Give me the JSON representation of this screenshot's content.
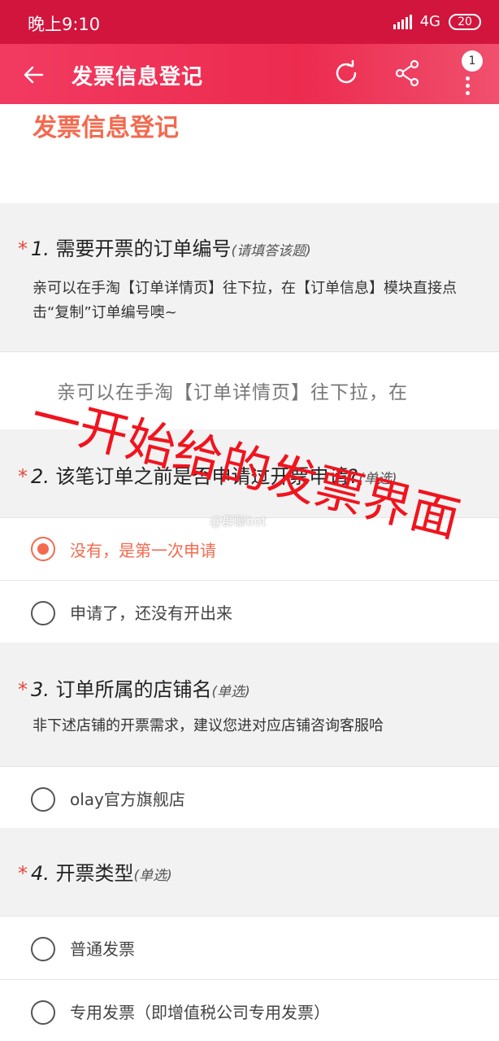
{
  "status_bar": {
    "time": "晚上9:10",
    "network": "4G",
    "battery": "20"
  },
  "app_bar": {
    "title": "发票信息登记",
    "badge_count": "1"
  },
  "form": {
    "title": "发票信息登记"
  },
  "questions": [
    {
      "star": "*",
      "number": "1.",
      "title": "需要开票的订单编号",
      "hint": "(请填答该题)",
      "description": "亲可以在手淘【订单详情页】往下拉，在【订单信息】模块直接点击“复制”订单编号噢~",
      "answer_placeholder": "亲可以在手淘【订单详情页】往下拉，在"
    },
    {
      "star": "*",
      "number": "2.",
      "title": "该笔订单之前是否申请过开票申请?",
      "hint": "(单选)",
      "options": [
        {
          "label": "没有，是第一次申请",
          "selected": true
        },
        {
          "label": "申请了，还没有开出来",
          "selected": false
        }
      ]
    },
    {
      "star": "*",
      "number": "3.",
      "title": "订单所属的店铺名",
      "hint": "(单选)",
      "description": "非下述店铺的开票需求，建议您进对应店铺咨询客服哈",
      "options": [
        {
          "label": "olay官方旗舰店",
          "selected": false
        }
      ]
    },
    {
      "star": "*",
      "number": "4.",
      "title": "开票类型",
      "hint": "(单选)",
      "options": [
        {
          "label": "普通发票",
          "selected": false
        },
        {
          "label": "专用发票（即增值税公司专用发票）",
          "selected": false
        }
      ]
    }
  ],
  "overlay_text": "一开始给的发票界面",
  "watermark": "@群聊bot",
  "colors": {
    "status_bar": "#d2153d",
    "app_bar": "#ec2b4f",
    "accent": "#f36a4f",
    "overlay": "#f0141e"
  },
  "icons": {
    "back": "arrow-left-icon",
    "refresh": "refresh-icon",
    "share": "share-icon",
    "more": "more-vertical-icon"
  }
}
